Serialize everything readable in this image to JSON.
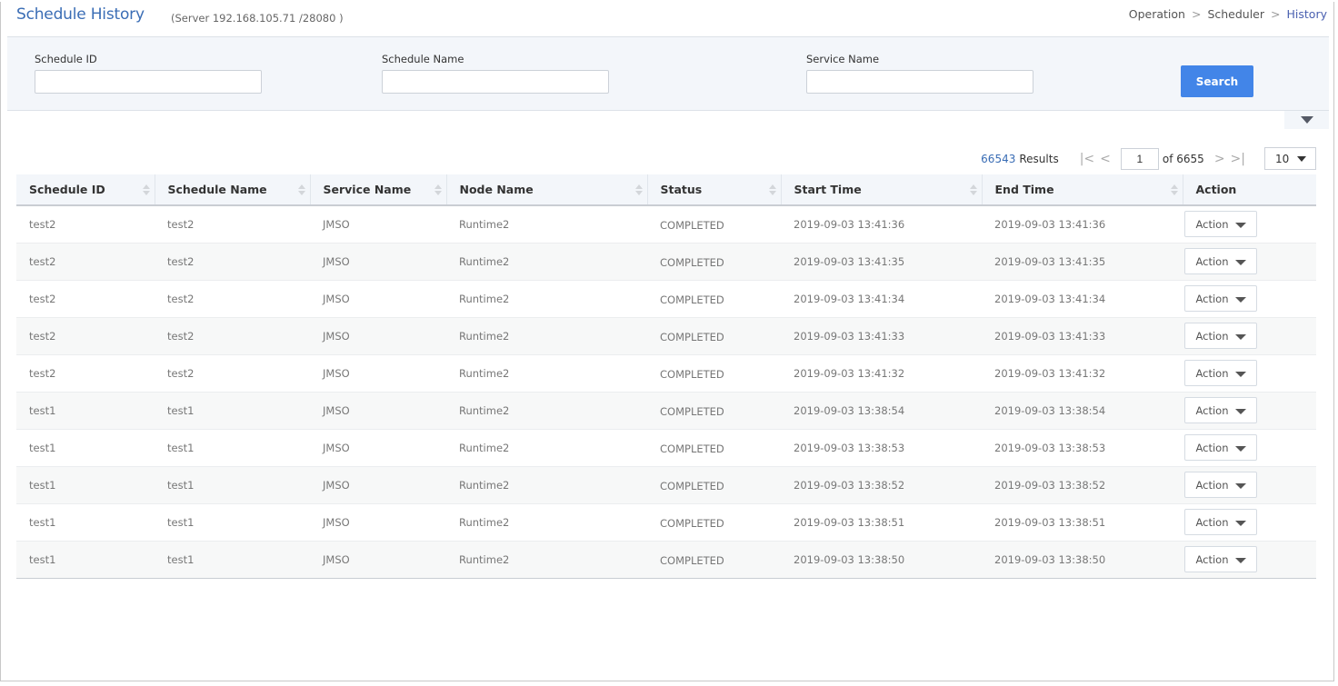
{
  "header": {
    "title": "Schedule History",
    "server_info": "(Server  192.168.105.71 /28080 )",
    "breadcrumb": [
      "Operation",
      "Scheduler",
      "History"
    ],
    "breadcrumb_separator": ">"
  },
  "search": {
    "fields": [
      {
        "label": "Schedule ID",
        "value": "",
        "placeholder": ""
      },
      {
        "label": "Schedule Name",
        "value": "",
        "placeholder": ""
      },
      {
        "label": "Service Name",
        "value": "",
        "placeholder": ""
      }
    ],
    "search_label": "Search",
    "collapse_icon": "caret-down-icon"
  },
  "pagination": {
    "total_results": "66543",
    "results_label": "Results",
    "first_icon": "|<",
    "prev_icon": "<",
    "current_page": "1",
    "of_label": "of 6655",
    "next_icon": ">",
    "last_icon": ">|",
    "page_size": "10"
  },
  "table": {
    "columns": [
      {
        "label": "Schedule ID",
        "sortable": true
      },
      {
        "label": "Schedule Name",
        "sortable": true
      },
      {
        "label": "Service Name",
        "sortable": true
      },
      {
        "label": "Node Name",
        "sortable": true
      },
      {
        "label": "Status",
        "sortable": true
      },
      {
        "label": "Start Time",
        "sortable": true
      },
      {
        "label": "End Time",
        "sortable": true
      },
      {
        "label": "Action",
        "sortable": false
      }
    ],
    "action_label": "Action",
    "rows": [
      {
        "schedule_id": "test2",
        "schedule_name": "test2",
        "service_name": "JMSO",
        "node_name": "Runtime2",
        "status": "COMPLETED",
        "start_time": "2019-09-03 13:41:36",
        "end_time": "2019-09-03 13:41:36"
      },
      {
        "schedule_id": "test2",
        "schedule_name": "test2",
        "service_name": "JMSO",
        "node_name": "Runtime2",
        "status": "COMPLETED",
        "start_time": "2019-09-03 13:41:35",
        "end_time": "2019-09-03 13:41:35"
      },
      {
        "schedule_id": "test2",
        "schedule_name": "test2",
        "service_name": "JMSO",
        "node_name": "Runtime2",
        "status": "COMPLETED",
        "start_time": "2019-09-03 13:41:34",
        "end_time": "2019-09-03 13:41:34"
      },
      {
        "schedule_id": "test2",
        "schedule_name": "test2",
        "service_name": "JMSO",
        "node_name": "Runtime2",
        "status": "COMPLETED",
        "start_time": "2019-09-03 13:41:33",
        "end_time": "2019-09-03 13:41:33"
      },
      {
        "schedule_id": "test2",
        "schedule_name": "test2",
        "service_name": "JMSO",
        "node_name": "Runtime2",
        "status": "COMPLETED",
        "start_time": "2019-09-03 13:41:32",
        "end_time": "2019-09-03 13:41:32"
      },
      {
        "schedule_id": "test1",
        "schedule_name": "test1",
        "service_name": "JMSO",
        "node_name": "Runtime2",
        "status": "COMPLETED",
        "start_time": "2019-09-03 13:38:54",
        "end_time": "2019-09-03 13:38:54"
      },
      {
        "schedule_id": "test1",
        "schedule_name": "test1",
        "service_name": "JMSO",
        "node_name": "Runtime2",
        "status": "COMPLETED",
        "start_time": "2019-09-03 13:38:53",
        "end_time": "2019-09-03 13:38:53"
      },
      {
        "schedule_id": "test1",
        "schedule_name": "test1",
        "service_name": "JMSO",
        "node_name": "Runtime2",
        "status": "COMPLETED",
        "start_time": "2019-09-03 13:38:52",
        "end_time": "2019-09-03 13:38:52"
      },
      {
        "schedule_id": "test1",
        "schedule_name": "test1",
        "service_name": "JMSO",
        "node_name": "Runtime2",
        "status": "COMPLETED",
        "start_time": "2019-09-03 13:38:51",
        "end_time": "2019-09-03 13:38:51"
      },
      {
        "schedule_id": "test1",
        "schedule_name": "test1",
        "service_name": "JMSO",
        "node_name": "Runtime2",
        "status": "COMPLETED",
        "start_time": "2019-09-03 13:38:50",
        "end_time": "2019-09-03 13:38:50"
      }
    ]
  },
  "colors": {
    "accent": "#4285e8",
    "title": "#3a6db5",
    "panel_bg": "#f3f6fa"
  }
}
